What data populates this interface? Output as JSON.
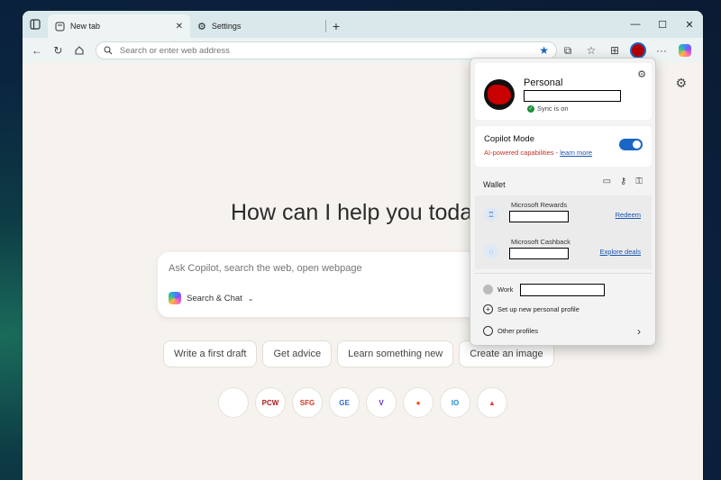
{
  "tabs": [
    {
      "label": "New tab",
      "active": true
    },
    {
      "label": "Settings",
      "active": false
    }
  ],
  "window_controls": {
    "minimize": "—",
    "maximize": "☐",
    "close": "✕"
  },
  "omnibox": {
    "placeholder": "Search or enter web address"
  },
  "page": {
    "headline": "How can I help you toda",
    "copilot_placeholder": "Ask Copilot, search the web, open webpage",
    "search_mode": "Search & Chat",
    "chips": [
      "Write a first draft",
      "Get advice",
      "Learn something new",
      "Create an image"
    ],
    "tiles": [
      {
        "name": "blank",
        "label": "",
        "color": "#ffffff"
      },
      {
        "name": "pcw",
        "label": "PCW",
        "color": "#b3191c"
      },
      {
        "name": "sfg",
        "label": "SFG",
        "color": "#d43a2a"
      },
      {
        "name": "news",
        "label": "GE",
        "color": "#2a6ed1"
      },
      {
        "name": "verizon",
        "label": "V",
        "color": "#5a2bd1"
      },
      {
        "name": "reddit",
        "label": "●",
        "color": "#ff4500"
      },
      {
        "name": "io",
        "label": "IO",
        "color": "#1a8ed8"
      },
      {
        "name": "monday",
        "label": "▲",
        "color": "#e9433b"
      }
    ]
  },
  "profile_panel": {
    "profile_name": "Personal",
    "sync_status": "Sync is on",
    "copilot_mode": {
      "title": "Copilot Mode",
      "subtitle": "AI-powered capabilities - ",
      "link": "learn more",
      "enabled": true
    },
    "wallet": {
      "title": "Wallet",
      "items": [
        {
          "title": "Microsoft Rewards",
          "action": "Redeem"
        },
        {
          "title": "Microsoft Cashback",
          "action": "Explore deals"
        }
      ]
    },
    "work_label": "Work",
    "setup_label": "Set up new personal profile",
    "other_profiles": "Other profiles"
  }
}
